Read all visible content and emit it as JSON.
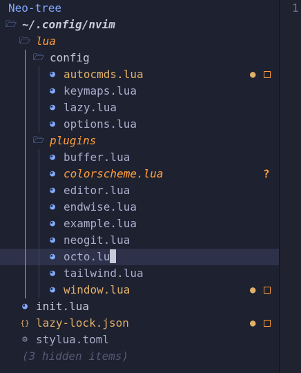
{
  "tree": {
    "title": "Neo-tree",
    "root": "~/.config/nvim",
    "hidden_items": "(3 hidden items)",
    "rows": [
      {
        "label": "lua",
        "kind": "folder",
        "depth": 1,
        "color": "#ff9e3b",
        "italic": true
      },
      {
        "label": "config",
        "kind": "folder",
        "depth": 2,
        "color": "#c8ccda",
        "italic": false
      },
      {
        "label": "autocmds.lua",
        "kind": "lua",
        "depth": 3,
        "color": "#e0af68",
        "italic": false,
        "status": "modified"
      },
      {
        "label": "keymaps.lua",
        "kind": "lua",
        "depth": 3,
        "color": "#a8aecb",
        "italic": false
      },
      {
        "label": "lazy.lua",
        "kind": "lua",
        "depth": 3,
        "color": "#a8aecb",
        "italic": false
      },
      {
        "label": "options.lua",
        "kind": "lua",
        "depth": 3,
        "color": "#a8aecb",
        "italic": false
      },
      {
        "label": "plugins",
        "kind": "folder",
        "depth": 2,
        "color": "#ff9e3b",
        "italic": true
      },
      {
        "label": "buffer.lua",
        "kind": "lua",
        "depth": 3,
        "color": "#a8aecb",
        "italic": false
      },
      {
        "label": "colorscheme.lua",
        "kind": "lua",
        "depth": 3,
        "color": "#ff9e3b",
        "italic": true,
        "status": "untracked"
      },
      {
        "label": "editor.lua",
        "kind": "lua",
        "depth": 3,
        "color": "#a8aecb",
        "italic": false
      },
      {
        "label": "endwise.lua",
        "kind": "lua",
        "depth": 3,
        "color": "#a8aecb",
        "italic": false
      },
      {
        "label": "example.lua",
        "kind": "lua",
        "depth": 3,
        "color": "#a8aecb",
        "italic": false
      },
      {
        "label": "neogit.lua",
        "kind": "lua",
        "depth": 3,
        "color": "#a8aecb",
        "italic": false
      },
      {
        "label": "octo.lua",
        "kind": "lua",
        "depth": 3,
        "color": "#a8aecb",
        "italic": false,
        "selected": true
      },
      {
        "label": "tailwind.lua",
        "kind": "lua",
        "depth": 3,
        "color": "#a8aecb",
        "italic": false
      },
      {
        "label": "window.lua",
        "kind": "lua",
        "depth": 3,
        "color": "#e0af68",
        "italic": false,
        "status": "modified"
      },
      {
        "label": "init.lua",
        "kind": "lua",
        "depth": 1,
        "color": "#c8ccda",
        "italic": false
      },
      {
        "label": "lazy-lock.json",
        "kind": "json",
        "depth": 1,
        "color": "#e0af68",
        "italic": false,
        "status": "modified"
      },
      {
        "label": "stylua.toml",
        "kind": "config",
        "depth": 1,
        "color": "#a8aecb",
        "italic": false
      }
    ]
  },
  "editor": {
    "line_number": "1"
  },
  "colors": {
    "background": "#1e2130",
    "title": "#82aaff",
    "folder_icon": "#82aaff",
    "lua_icon": "#82aaff",
    "json_icon": "#e0af68",
    "config_icon": "#8a90a8",
    "hidden": "#545a74",
    "guide": "#4fc1ff"
  },
  "icons": {
    "folder": "folder-open-icon",
    "lua": "lua-moon-icon",
    "json": "json-braces-icon",
    "config": "gear-icon",
    "modified": "dot-icon",
    "unsaved": "square-icon",
    "untracked": "question-icon"
  }
}
